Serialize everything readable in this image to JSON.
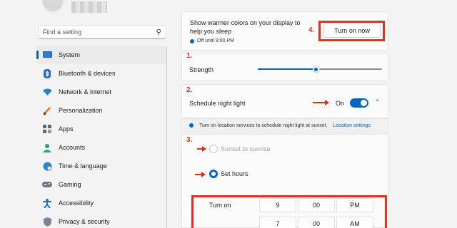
{
  "sidebar": {
    "search_placeholder": "Find a setting",
    "items": [
      {
        "label": "System",
        "icon": "monitor-icon",
        "active": true
      },
      {
        "label": "Bluetooth & devices",
        "icon": "bluetooth-icon"
      },
      {
        "label": "Network & internet",
        "icon": "wifi-icon"
      },
      {
        "label": "Personalization",
        "icon": "brush-icon"
      },
      {
        "label": "Apps",
        "icon": "apps-icon"
      },
      {
        "label": "Accounts",
        "icon": "person-icon"
      },
      {
        "label": "Time & language",
        "icon": "globe-icon"
      },
      {
        "label": "Gaming",
        "icon": "controller-icon"
      },
      {
        "label": "Accessibility",
        "icon": "accessibility-icon"
      },
      {
        "label": "Privacy & security",
        "icon": "shield-icon"
      }
    ]
  },
  "night_light": {
    "warm_text": "Show warmer colors on your display to help you sleep",
    "status": "Off until 9:00 PM",
    "turn_on_label": "Turn on now",
    "strength_label": "Strength",
    "strength_value": 0.47,
    "schedule_label": "Schedule night light",
    "schedule_state": "On",
    "info_text": "Turn on location services to schedule night light at sunset.",
    "info_link": "Location settings",
    "option_sunset": "Sunset to sunrise",
    "option_set_hours": "Set hours",
    "turn_on_time": {
      "label": "Turn on",
      "hour": "9",
      "minute": "00",
      "ampm": "PM"
    },
    "turn_off_time": {
      "hour": "7",
      "minute": "00",
      "ampm": "AM"
    }
  },
  "annotations": {
    "n1": "1.",
    "n2": "2.",
    "n3": "3.",
    "n4": "4."
  },
  "colors": {
    "accent": "#0067c0",
    "annotation": "#e0331f"
  }
}
